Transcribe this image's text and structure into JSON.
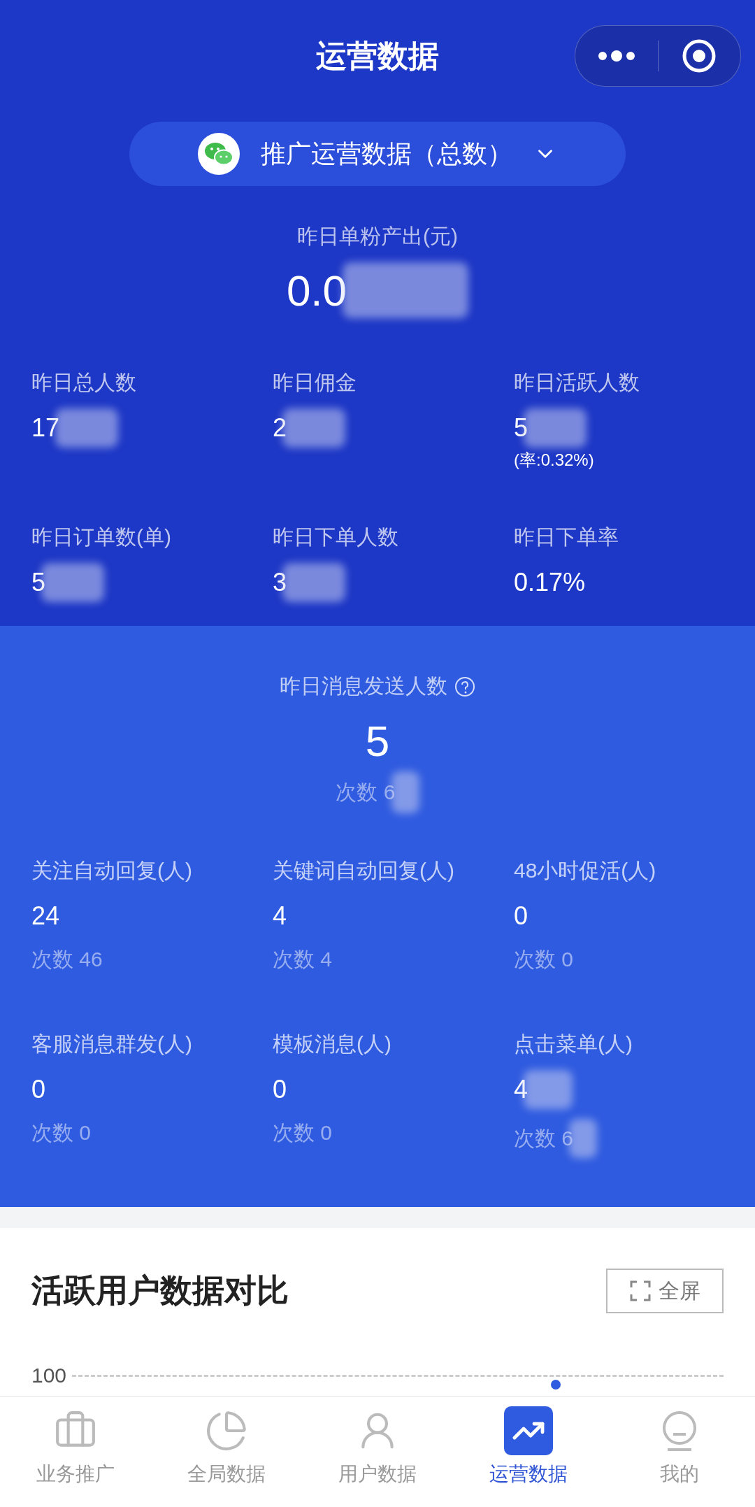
{
  "header": {
    "title": "运营数据"
  },
  "selector": {
    "label": "推广运营数据（总数）"
  },
  "headline": {
    "label": "昨日单粉产出(元)",
    "value": "0.0",
    "redacted": true
  },
  "stats": [
    {
      "label": "昨日总人数",
      "value": "17",
      "redacted": true
    },
    {
      "label": "昨日佣金",
      "value": "2",
      "redacted": true
    },
    {
      "label": "昨日活跃人数",
      "value": "5",
      "redacted": true,
      "note": "(率:0.32%)"
    },
    {
      "label": "昨日订单数(单)",
      "value": "5",
      "redacted": true
    },
    {
      "label": "昨日下单人数",
      "value": "3",
      "redacted": true
    },
    {
      "label": "昨日下单率",
      "value": "0.17%",
      "redacted": false
    }
  ],
  "messages": {
    "label": "昨日消息发送人数",
    "value": "5",
    "count": "次数 6",
    "count_redacted": true
  },
  "message_stats": [
    {
      "label": "关注自动回复(人)",
      "value": "24",
      "redacted": false,
      "count": "次数 46",
      "count_redacted": false
    },
    {
      "label": "关键词自动回复(人)",
      "value": "4",
      "redacted": false,
      "count": "次数 4",
      "count_redacted": false
    },
    {
      "label": "48小时促活(人)",
      "value": "0",
      "redacted": false,
      "count": "次数 0",
      "count_redacted": false
    },
    {
      "label": "客服消息群发(人)",
      "value": "0",
      "redacted": false,
      "count": "次数 0",
      "count_redacted": false
    },
    {
      "label": "模板消息(人)",
      "value": "0",
      "redacted": false,
      "count": "次数 0",
      "count_redacted": false
    },
    {
      "label": "点击菜单(人)",
      "value": "4",
      "redacted": true,
      "count": "次数 6",
      "count_redacted": true
    }
  ],
  "card": {
    "title": "活跃用户数据对比",
    "fullscreen": "全屏",
    "axis_label": "100"
  },
  "tabs": [
    {
      "label": "业务推广",
      "kind": "briefcase",
      "selected": false
    },
    {
      "label": "全局数据",
      "kind": "pie",
      "selected": false
    },
    {
      "label": "用户数据",
      "kind": "user",
      "selected": false
    },
    {
      "label": "运营数据",
      "kind": "trend",
      "selected": true
    },
    {
      "label": "我的",
      "kind": "face",
      "selected": false
    }
  ]
}
